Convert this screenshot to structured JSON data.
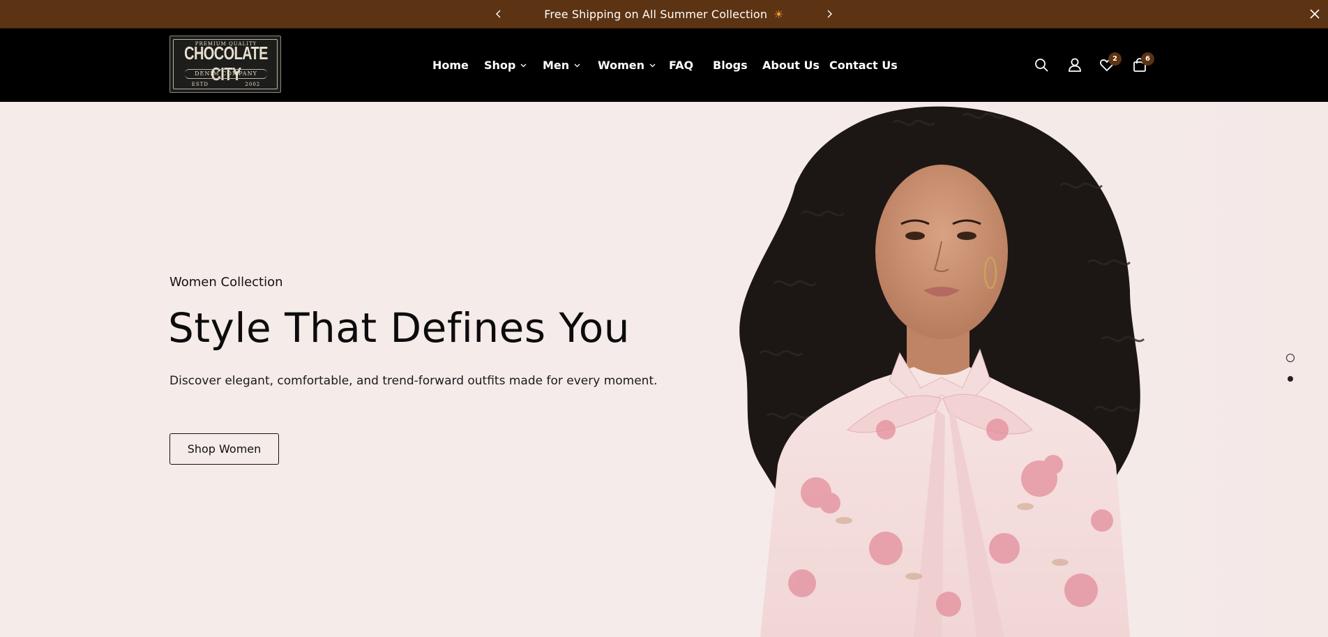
{
  "announcement": {
    "message": "Free Shipping on All Summer Collection",
    "emoji": "☀",
    "background": "#5c3313"
  },
  "logo": {
    "line1": "PREMIUM QUALITY",
    "line2": "CHOCOLATE CITY",
    "line3": "DENIM COMPANY",
    "line4_left": "ESTD",
    "line4_right": "2002"
  },
  "nav": {
    "items": [
      {
        "label": "Home",
        "has_dropdown": false
      },
      {
        "label": "Shop",
        "has_dropdown": true
      },
      {
        "label": "Men",
        "has_dropdown": true
      },
      {
        "label": "Women",
        "has_dropdown": true
      },
      {
        "label": "FAQ",
        "has_dropdown": false
      },
      {
        "label": "Blogs",
        "has_dropdown": false
      },
      {
        "label": "About Us",
        "has_dropdown": false
      },
      {
        "label": "Contact Us",
        "has_dropdown": false
      }
    ]
  },
  "header_icons": {
    "search": "search-icon",
    "account": "user-icon",
    "wishlist": "heart-icon",
    "wishlist_count": "2",
    "cart": "shopping-bag-icon",
    "cart_count": "6"
  },
  "hero": {
    "eyebrow": "Women Collection",
    "headline": "Style That Defines You",
    "description": "Discover elegant, comfortable, and trend-forward outfits made for every moment.",
    "cta_label": "Shop Women",
    "slides_total": 2,
    "active_slide": 2
  },
  "colors": {
    "accent_brown": "#5c3313",
    "header_bg": "#000000",
    "hero_bg": "#f5ebe8"
  }
}
